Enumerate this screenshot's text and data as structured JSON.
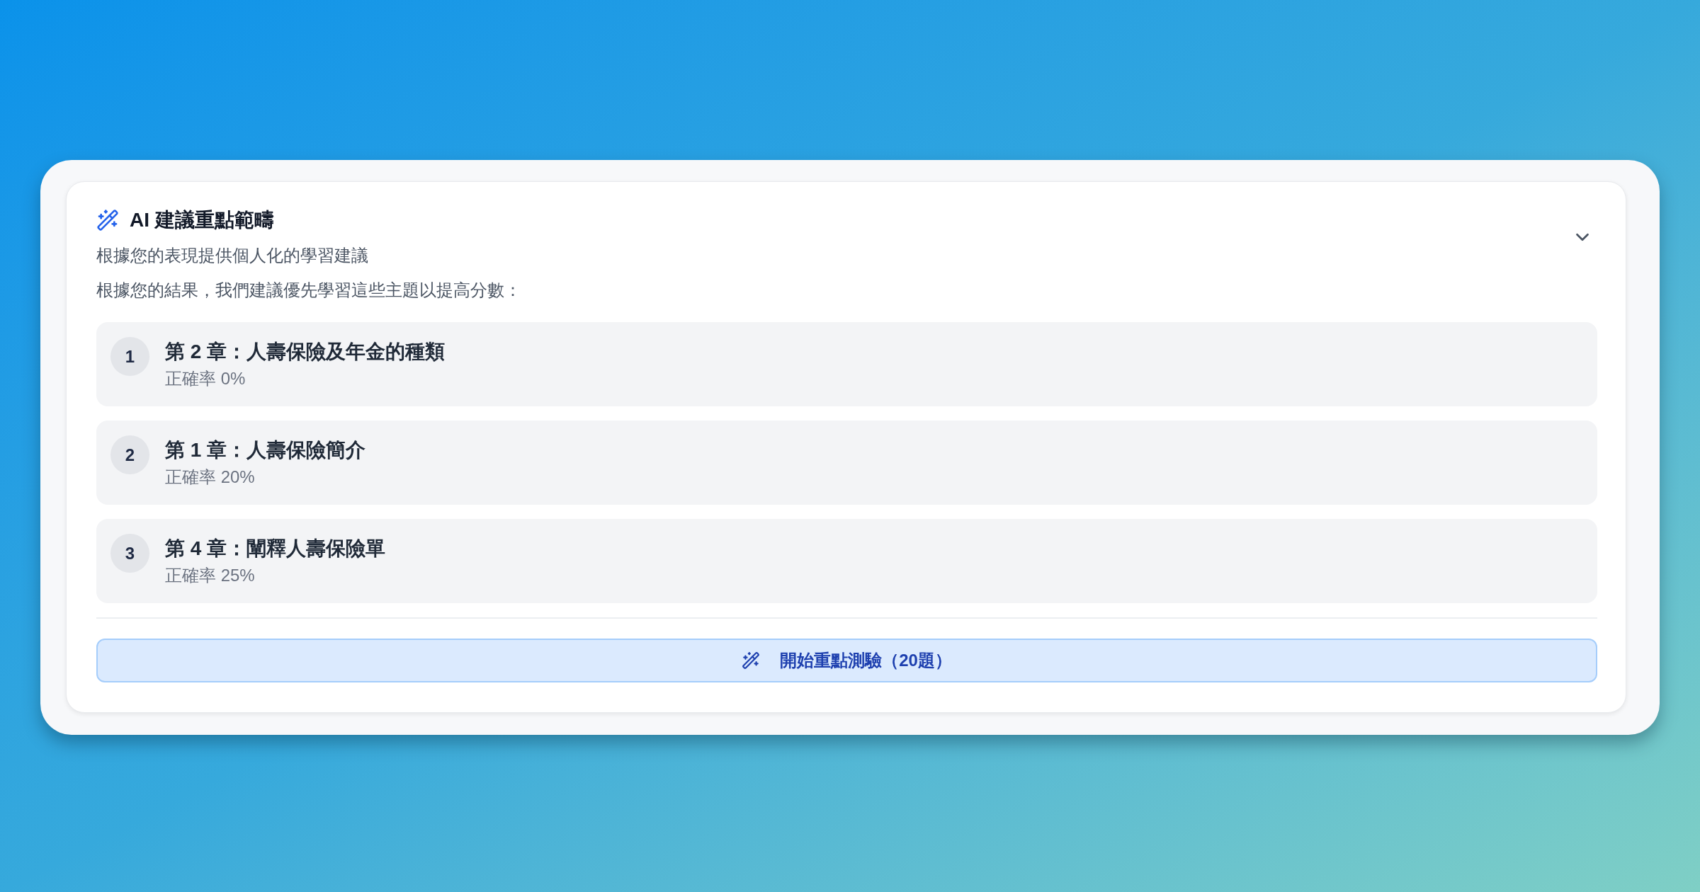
{
  "panel": {
    "title": "AI 建議重點範疇",
    "subtitle": "根據您的表現提供個人化的學習建議",
    "expanded": true,
    "intro": "根據您的結果，我們建議優先學習這些主題以提高分數：",
    "topics": [
      {
        "rank": "1",
        "title": "第 2 章：人壽保險及年金的種類",
        "accuracy": "正確率 0%"
      },
      {
        "rank": "2",
        "title": "第 1 章：人壽保險簡介",
        "accuracy": "正確率 20%"
      },
      {
        "rank": "3",
        "title": "第 4 章：闡釋人壽保險單",
        "accuracy": "正確率 25%"
      }
    ],
    "start_button": {
      "label": "開始重點測驗（20題）"
    }
  }
}
